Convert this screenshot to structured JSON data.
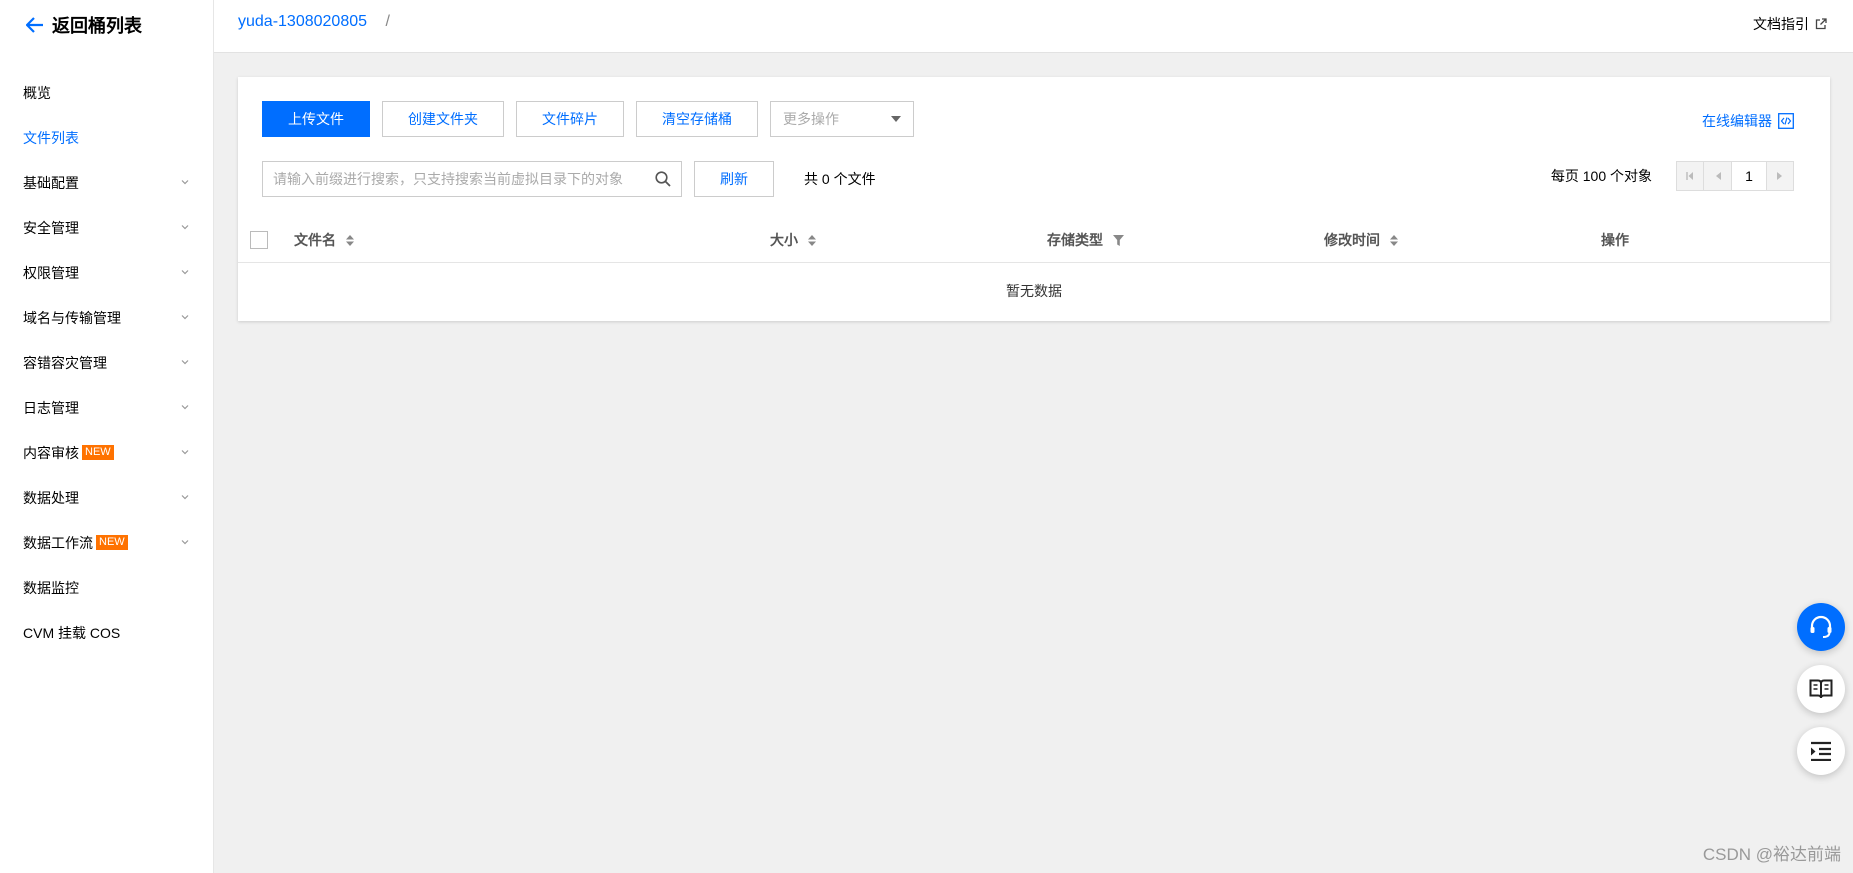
{
  "sidebar": {
    "back_label": "返回桶列表",
    "items": [
      {
        "label": "概览",
        "has_chevron": false,
        "badge": ""
      },
      {
        "label": "文件列表",
        "has_chevron": false,
        "badge": "",
        "active": true
      },
      {
        "label": "基础配置",
        "has_chevron": true,
        "badge": ""
      },
      {
        "label": "安全管理",
        "has_chevron": true,
        "badge": ""
      },
      {
        "label": "权限管理",
        "has_chevron": true,
        "badge": ""
      },
      {
        "label": "域名与传输管理",
        "has_chevron": true,
        "badge": ""
      },
      {
        "label": "容错容灾管理",
        "has_chevron": true,
        "badge": ""
      },
      {
        "label": "日志管理",
        "has_chevron": true,
        "badge": ""
      },
      {
        "label": "内容审核",
        "has_chevron": true,
        "badge": "NEW"
      },
      {
        "label": "数据处理",
        "has_chevron": true,
        "badge": ""
      },
      {
        "label": "数据工作流",
        "has_chevron": true,
        "badge": "NEW"
      },
      {
        "label": "数据监控",
        "has_chevron": false,
        "badge": ""
      },
      {
        "label": "CVM 挂载 COS",
        "has_chevron": false,
        "badge": ""
      }
    ]
  },
  "header": {
    "bucket": "yuda-1308020805",
    "separator": "/",
    "doc_link": "文档指引"
  },
  "toolbar": {
    "upload": "上传文件",
    "create_folder": "创建文件夹",
    "fragments": "文件碎片",
    "clear_bucket": "清空存储桶",
    "more_actions": "更多操作",
    "online_editor": "在线编辑器"
  },
  "search": {
    "placeholder": "请输入前缀进行搜索，只支持搜索当前虚拟目录下的对象",
    "refresh": "刷新",
    "count_text": "共 0 个文件"
  },
  "pager": {
    "per_page": "每页 100 个对象",
    "page": "1"
  },
  "table": {
    "columns": [
      "文件名",
      "大小",
      "存储类型",
      "修改时间",
      "操作"
    ],
    "empty_text": "暂无数据"
  },
  "watermark": "CSDN @裕达前端",
  "colors": {
    "accent": "#006eff",
    "badge": "#ff7200"
  }
}
